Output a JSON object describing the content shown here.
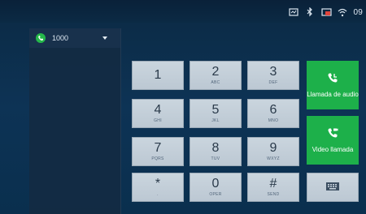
{
  "status_bar": {
    "time": "09",
    "icons": [
      "screen-icon",
      "bluetooth-icon",
      "cast-icon",
      "wifi-icon"
    ]
  },
  "account": {
    "number": "1000",
    "badge_color": "#25b84a"
  },
  "keypad": {
    "keys": [
      {
        "digit": "1",
        "letters": ""
      },
      {
        "digit": "2",
        "letters": "ABC"
      },
      {
        "digit": "3",
        "letters": "DEF"
      },
      {
        "digit": "4",
        "letters": "GHI"
      },
      {
        "digit": "5",
        "letters": "JKL"
      },
      {
        "digit": "6",
        "letters": "MNO"
      },
      {
        "digit": "7",
        "letters": "PQRS"
      },
      {
        "digit": "8",
        "letters": "TUV"
      },
      {
        "digit": "9",
        "letters": "WXYZ"
      },
      {
        "digit": "*",
        "letters": "."
      },
      {
        "digit": "0",
        "letters": "OPER"
      },
      {
        "digit": "#",
        "letters": "SEND"
      }
    ]
  },
  "actions": {
    "audio_call_label": "Llamada de audio",
    "video_call_label": "Video llamada",
    "accent_color": "#1db04a"
  }
}
